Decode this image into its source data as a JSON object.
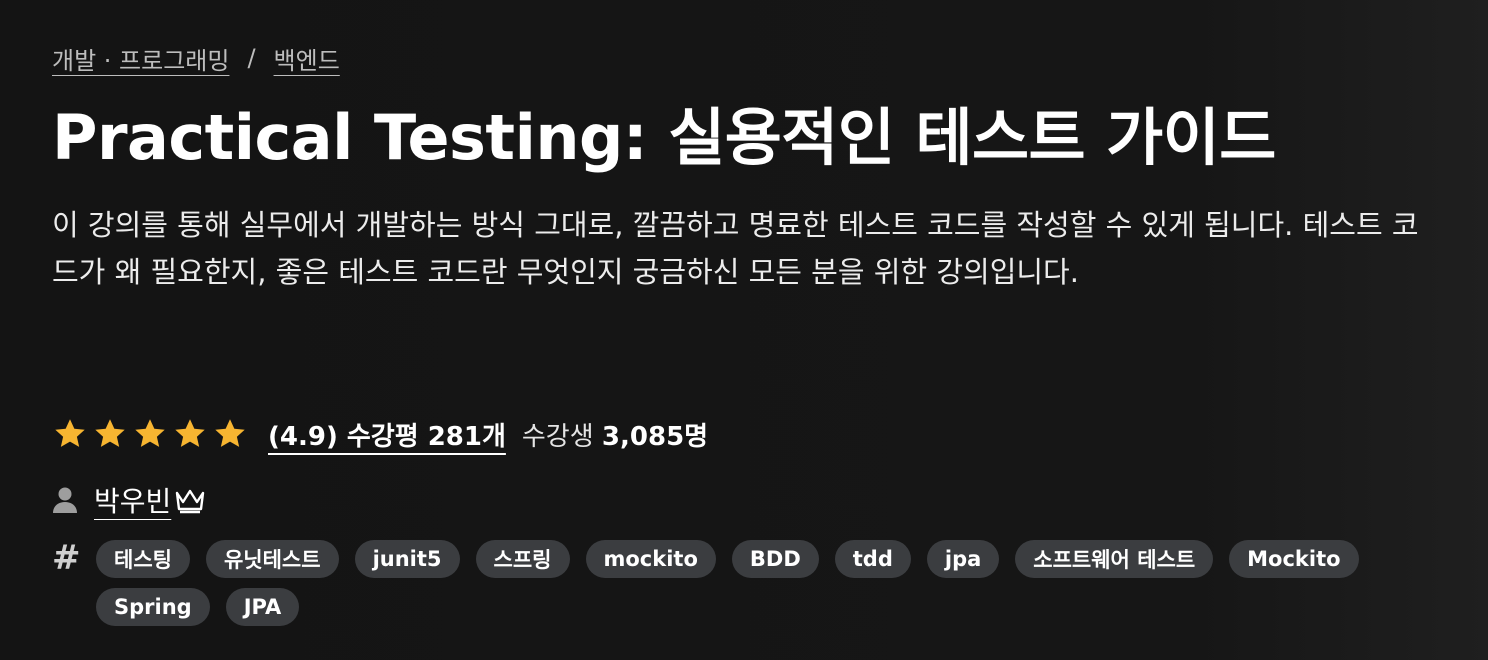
{
  "breadcrumb": {
    "category": "개발 · 프로그래밍",
    "separator": "/",
    "subcategory": "백엔드"
  },
  "course": {
    "title": "Practical Testing: 실용적인 테스트 가이드",
    "description": "이 강의를 통해 실무에서 개발하는 방식 그대로, 깔끔하고 명료한 테스트 코드를 작성할 수 있게 됩니다. 테스트 코드가 왜 필요한지, 좋은 테스트 코드란 무엇인지 궁금하신 모든 분을 위한 강의입니다."
  },
  "rating": {
    "stars": 5,
    "score": 4.9,
    "review_text": "(4.9) 수강평 281개",
    "students_label": "수강생",
    "students_count": "3,085명",
    "star_color": "#f7b531"
  },
  "author": {
    "icon": "person-icon",
    "name": "박우빈",
    "badge_icon": "crown-icon"
  },
  "tags": {
    "icon": "#",
    "items": [
      "테스팅",
      "유닛테스트",
      "junit5",
      "스프링",
      "mockito",
      "BDD",
      "tdd",
      "jpa",
      "소프트웨어 테스트",
      "Mockito",
      "Spring",
      "JPA"
    ]
  }
}
